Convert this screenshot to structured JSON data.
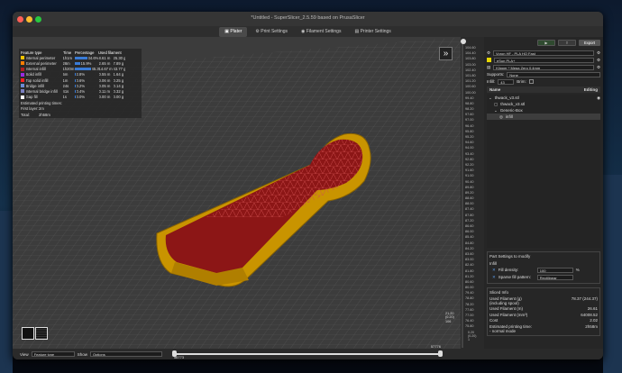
{
  "window": {
    "title": "*Untitled - SuperSlicer_2.5.59 based on PrusaSlicer"
  },
  "tabs": [
    {
      "label": "Plater",
      "selected": true
    },
    {
      "label": "Print Settings"
    },
    {
      "label": "Filament Settings"
    },
    {
      "label": "Printer Settings"
    }
  ],
  "legend": {
    "headers": [
      "Feature type",
      "Time",
      "Percentage",
      "Used filament"
    ],
    "rows": [
      {
        "label": "Internal perimeter",
        "time": "1h1m",
        "pct": "34.6%",
        "len": "8.61 m",
        "weight": "25.30 g",
        "color": "#f5c400",
        "frac": 0.346
      },
      {
        "label": "External perimeter",
        "time": "28m",
        "pct": "15.9%",
        "len": "2.65 m",
        "weight": "7.89 g",
        "color": "#ff7d00",
        "frac": 0.159
      },
      {
        "label": "Internal infill",
        "time": "1h20m",
        "pct": "45.3%",
        "len": "14.67 m",
        "weight": "43.77 g",
        "color": "#b02020",
        "frac": 0.453
      },
      {
        "label": "Solid infill",
        "time": "5m",
        "pct": "2.8%",
        "len": "0.55 m",
        "weight": "1.64 g",
        "color": "#9a2be0",
        "frac": 0.028
      },
      {
        "label": "Top solid infill",
        "time": "1m",
        "pct": "0.6%",
        "len": "0.06 m",
        "weight": "0.25 g",
        "color": "#ff1f1f",
        "frac": 0.006
      },
      {
        "label": "Bridge infill",
        "time": "24s",
        "pct": "0.2%",
        "len": "0.05 m",
        "weight": "0.14 g",
        "color": "#6d8bd4",
        "frac": 0.002
      },
      {
        "label": "Internal bridge infill",
        "time": "41s",
        "pct": "0.4%",
        "len": "0.11 m",
        "weight": "0.32 g",
        "color": "#7a7fc0",
        "frac": 0.004
      },
      {
        "label": "Gap fill",
        "time": "1s",
        "pct": "0.0%",
        "len": "0.00 m",
        "weight": "0.00 g",
        "color": "#ffffff",
        "frac": 0.0
      }
    ],
    "estimated_label": "Estimated printing times:",
    "first_layer_label": "First layer:",
    "first_layer_value": "2m",
    "total_label": "Total:",
    "total_value": "2h58m"
  },
  "ruler": {
    "top_values": [
      "104.60",
      "104.40",
      "103.80",
      "103.00",
      "102.40",
      "101.80",
      "101.20",
      "100.60",
      "100.00",
      "99.40",
      "98.80",
      "98.20",
      "97.60",
      "97.00",
      "96.40",
      "95.80",
      "95.20",
      "94.60",
      "94.00",
      "93.40",
      "92.80",
      "92.20",
      "91.60",
      "91.00",
      "90.40",
      "89.80",
      "89.20",
      "88.60",
      "88.00",
      "87.40",
      "87.80",
      "87.20",
      "86.60",
      "86.00",
      "85.40",
      "84.80",
      "84.20",
      "83.60",
      "83.00",
      "82.40",
      "81.80",
      "81.20",
      "80.60",
      "80.00",
      "79.40",
      "78.80",
      "78.20",
      "77.60",
      "77.00",
      "76.40",
      "75.80"
    ],
    "bottom_label": "0.20\n(0.20)\n1"
  },
  "side_label": {
    "value": "21.20\n(0.20)\n106"
  },
  "right": {
    "print_preset": "Voron HF - PLA HQ Fast",
    "filament_preset": "eSun PLA+",
    "printer_preset": "Klipper * Mega Zero 0.4mm",
    "supports_label": "Supports:",
    "supports_value": "None",
    "infill_label": "Infill:",
    "infill_value": "43",
    "brim_label": "Brim:",
    "col_name": "Name",
    "col_editing": "Editing",
    "tree": [
      "thwack_v3.stl",
      "thwack_v3.stl",
      "Generic-Box",
      "infill"
    ],
    "part_settings_title": "Part Settings to modify",
    "infill_section": "Infill",
    "fill_density_label": "Fill density:",
    "fill_density_value": "100",
    "fill_density_unit": "%",
    "sparse_pattern_label": "Sparse fill pattern:",
    "sparse_pattern_value": "Rectilinear",
    "sliced_title": "Sliced Info",
    "sliced_rows": [
      {
        "k": "Used Filament (g)\n(including spool)",
        "v": "78.37 (244.37)"
      },
      {
        "k": "Used Filament (m)",
        "v": "26.61"
      },
      {
        "k": "Used Filament (mm³)",
        "v": "64008.52"
      },
      {
        "k": "Cost",
        "v": "2.02"
      },
      {
        "k": "Estimated printing time:\n- normal mode",
        "v": "2h58m"
      }
    ],
    "export_button": "Export G-code",
    "top_export": "Export"
  },
  "bottom": {
    "view_label": "View",
    "view_value": "Feature type",
    "show_label": "Show",
    "show_value": "Options",
    "slider_left": "56773",
    "slider_right": "57776"
  }
}
